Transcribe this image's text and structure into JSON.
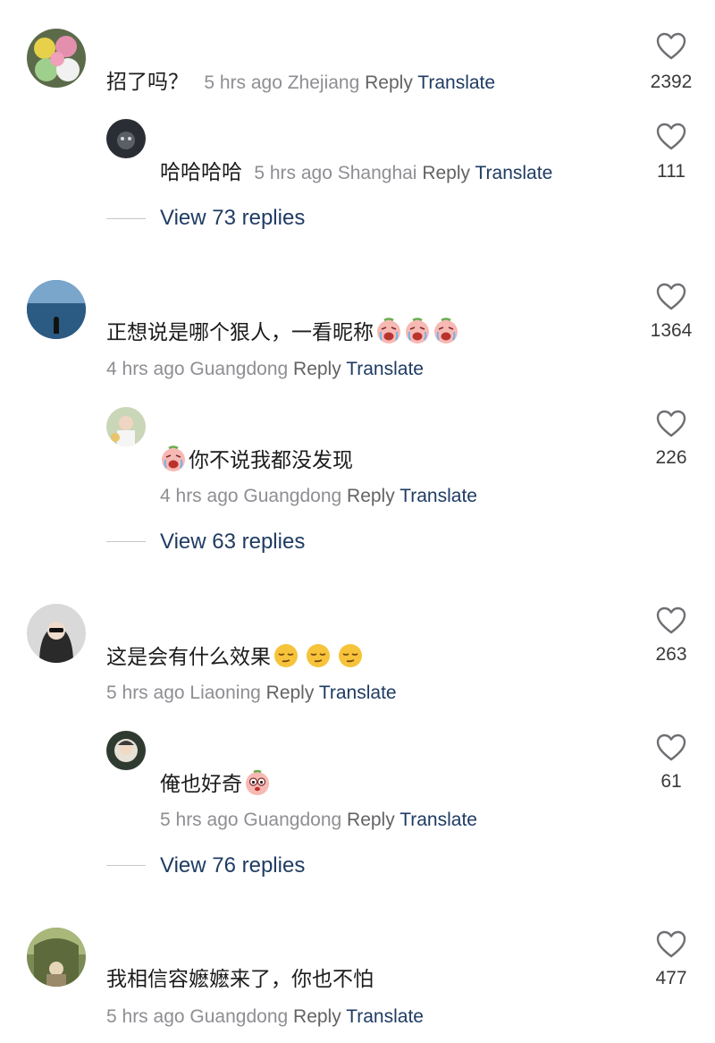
{
  "comments": [
    {
      "text": "招了吗？",
      "time": "5 hrs ago",
      "location": "Zhejiang",
      "reply": "Reply",
      "translate": "Translate",
      "likes": "2392",
      "sub": {
        "text": "哈哈哈哈",
        "time": "5 hrs ago",
        "location": "Shanghai",
        "reply": "Reply",
        "translate": "Translate",
        "likes": "111"
      },
      "view_replies": "View 73 replies"
    },
    {
      "text": "正想说是哪个狠人，一看昵称",
      "emojis": [
        "crying-face-emoji",
        "crying-face-emoji",
        "crying-face-emoji"
      ],
      "time": "4 hrs ago",
      "location": "Guangdong",
      "reply": "Reply",
      "translate": "Translate",
      "likes": "1364",
      "sub": {
        "text": "你不说我都没发现",
        "leading_emoji": "crying-face-emoji",
        "time": "4 hrs ago",
        "location": "Guangdong",
        "reply": "Reply",
        "translate": "Translate",
        "likes": "226"
      },
      "view_replies": "View 63 replies"
    },
    {
      "text": "这是会有什么效果",
      "emojis": [
        "relieved-face-emoji",
        "relieved-face-emoji",
        "relieved-face-emoji"
      ],
      "time": "5 hrs ago",
      "location": "Liaoning",
      "reply": "Reply",
      "translate": "Translate",
      "likes": "263",
      "sub": {
        "text": "俺也好奇",
        "trailing_emoji": "peeking-face-emoji",
        "time": "5 hrs ago",
        "location": "Guangdong",
        "reply": "Reply",
        "translate": "Translate",
        "likes": "61"
      },
      "view_replies": "View 76 replies"
    },
    {
      "text": "我相信容嬷嬷来了，你也不怕",
      "time": "5 hrs ago",
      "location": "Guangdong",
      "reply": "Reply",
      "translate": "Translate",
      "likes": "477"
    }
  ],
  "colors": {
    "text": "#1c1c1e",
    "meta": "#8e8e93",
    "reply": "#636366",
    "link": "#1f3b63",
    "heart": "#6e6e73"
  }
}
